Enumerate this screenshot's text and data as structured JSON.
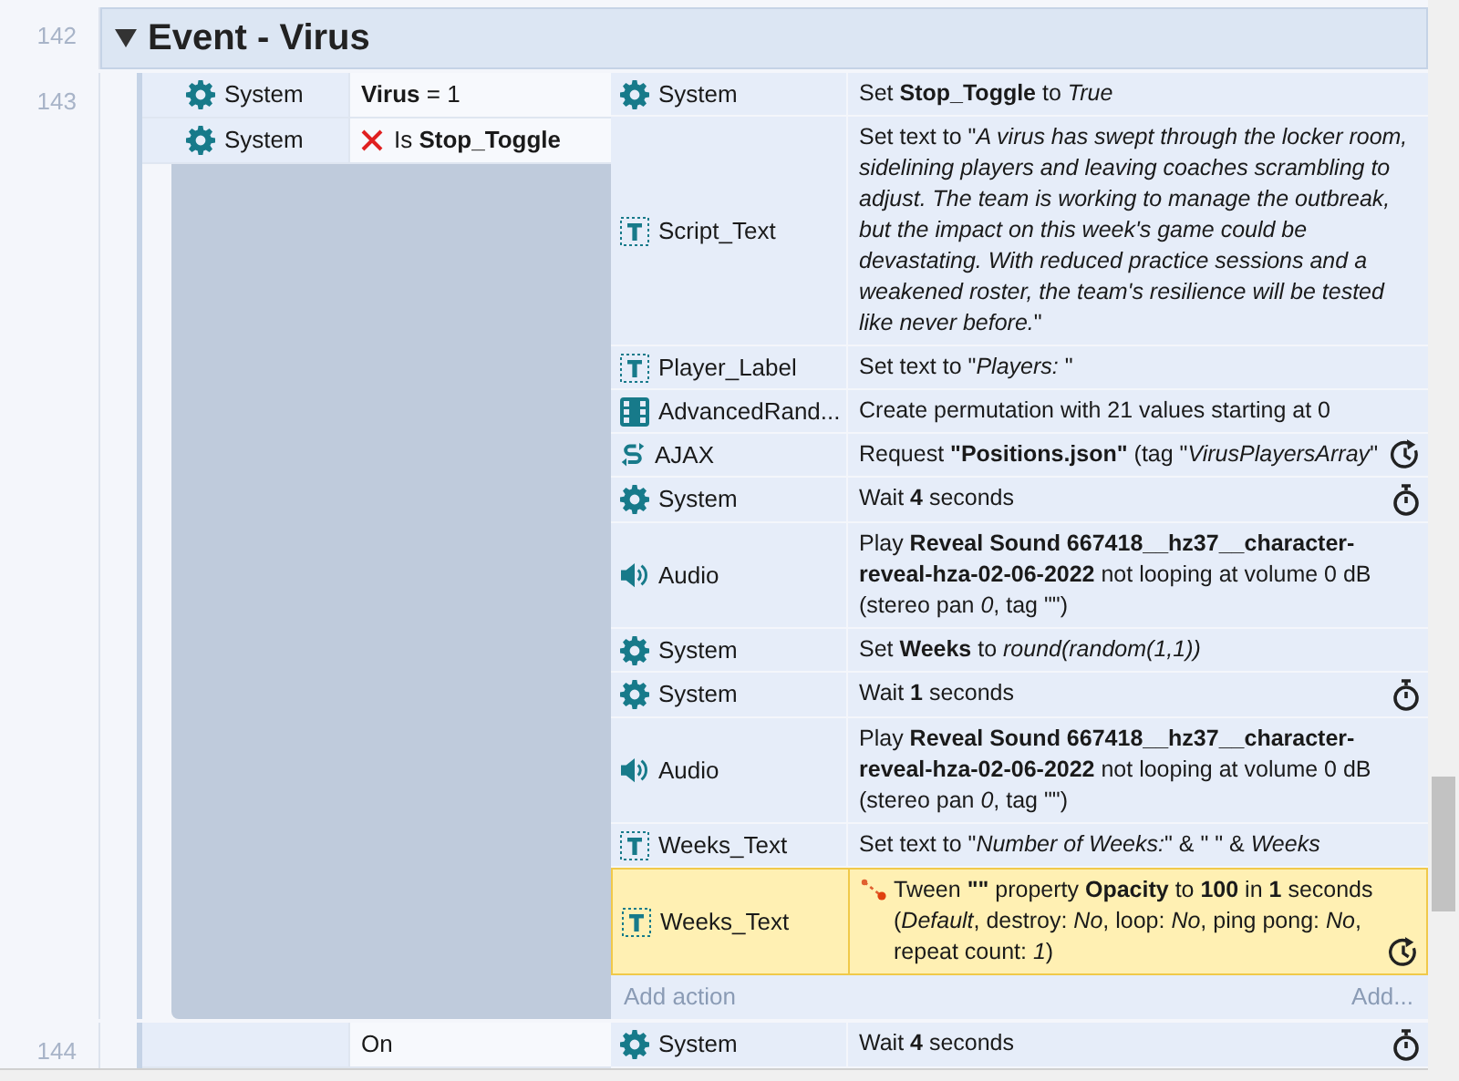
{
  "group": {
    "line": "142",
    "title": "Event - Virus",
    "expanded": true
  },
  "events": [
    {
      "line": "143",
      "conditions": [
        {
          "object": "System",
          "kind": "gear",
          "inverted": false,
          "text": "**Virus** = 1"
        },
        {
          "object": "System",
          "kind": "gear",
          "inverted": true,
          "text": "Is **Stop_Toggle**"
        }
      ],
      "actions": [
        {
          "object": "System",
          "kind": "gear",
          "text": "Set **Stop_Toggle** to *True*",
          "selected": false
        },
        {
          "object": "Script_Text",
          "kind": "text",
          "text": "Set text to \"*A virus has swept through the locker room, sidelining players and leaving coaches scrambling to adjust. The team is working to manage the outbreak, but the impact on this week's game could be devastating. With reduced practice sessions and a weakened roster, the team's resilience will be tested like never before.*\"",
          "selected": false
        },
        {
          "object": "Player_Label",
          "kind": "text",
          "text": "Set text to \"*Players:* \"",
          "selected": false
        },
        {
          "object": "AdvancedRand...",
          "kind": "random",
          "text": "Create permutation with 21 values starting at 0",
          "selected": false
        },
        {
          "object": "AJAX",
          "kind": "ajax",
          "text": "Request **\"Positions.json\"** (tag \"*VirusPlayersArray*\"",
          "async": true,
          "selected": false
        },
        {
          "object": "System",
          "kind": "gear",
          "text": "Wait **4** seconds",
          "wait": true,
          "selected": false
        },
        {
          "object": "Audio",
          "kind": "audio",
          "text": "Play **Reveal Sound 667418__hz37__character-reveal-hza-02-06-2022** not looping at volume 0 dB (stereo pan *0*, tag \"\")",
          "selected": false
        },
        {
          "object": "System",
          "kind": "gear",
          "text": "Set **Weeks** to *round(random(1,1))*",
          "selected": false
        },
        {
          "object": "System",
          "kind": "gear",
          "text": "Wait **1** seconds",
          "wait": true,
          "selected": false
        },
        {
          "object": "Audio",
          "kind": "audio",
          "text": "Play **Reveal Sound 667418__hz37__character-reveal-hza-02-06-2022** not looping at volume 0 dB (stereo pan *0*, tag \"\")",
          "selected": false
        },
        {
          "object": "Weeks_Text",
          "kind": "text",
          "text": "Set text to \"*Number of Weeks:*\" & \" \" & *Weeks*",
          "selected": false
        },
        {
          "object": "Weeks_Text",
          "kind": "text",
          "tween": true,
          "text": "Tween **\"\"** property **Opacity** to **100** in **1** seconds (*Default*, destroy: *No*, loop: *No*, ping pong: *No*, repeat count: *1*)",
          "async": true,
          "selected": true
        }
      ],
      "add_action": {
        "label": "Add action",
        "short": "Add..."
      }
    },
    {
      "line": "144",
      "conditions": [
        {
          "kind": "none",
          "inverted": false,
          "text": "On"
        }
      ],
      "actions": [
        {
          "object": "System",
          "kind": "gear",
          "text": "Wait **4** seconds",
          "wait": true,
          "selected": false
        }
      ]
    }
  ]
}
